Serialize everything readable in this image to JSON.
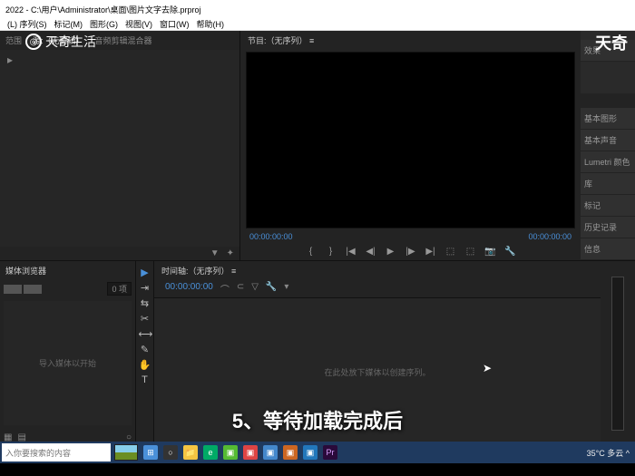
{
  "title_bar": {
    "title": "2022 - C:\\用户\\Administrator\\桌面\\图片文字去除.prproj"
  },
  "menu": {
    "items": [
      "(L) 序列(S)",
      "标记(M)",
      "图形(G)",
      "视图(V)",
      "窗口(W)",
      "帮助(H)"
    ]
  },
  "watermarks": {
    "left": "天奇生活",
    "right": "天奇"
  },
  "workspace": {
    "source_tabs": [
      "范围",
      "源:（无剪辑）",
      "音频剪辑混合器"
    ],
    "program_tab": "节目:（无序列） ≡",
    "tc_left": "00:00:00:00",
    "tc_right": "00:00:00:00",
    "right_panels": [
      "效果",
      "基本图形",
      "基本声音",
      "Lumetri 颜色",
      "库",
      "标记",
      "历史记录",
      "信息"
    ]
  },
  "project": {
    "tab": "媒体浏览器",
    "search_count": "0 项",
    "empty_msg": "导入媒体以开始"
  },
  "timeline": {
    "tab": "时间轴:（无序列） ≡",
    "tc": "00:00:00:00",
    "empty_msg": "在此处放下媒体以创建序列。"
  },
  "caption": "5、等待加载完成后",
  "taskbar": {
    "search_placeholder": "入你要搜索的内容",
    "weather": "35°C 多云 ^"
  }
}
